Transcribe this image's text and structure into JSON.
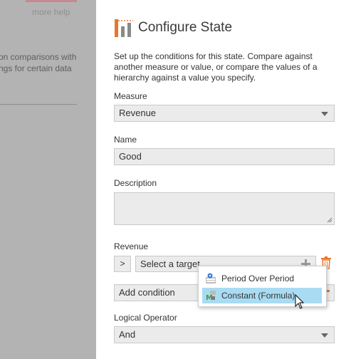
{
  "background": {
    "more_help": "more help",
    "desc_lines": [
      "on comparisons with",
      "ngs for certain data"
    ]
  },
  "dialog": {
    "title": "Configure State",
    "intro": "Set up the conditions for this state. Compare against another measure or value, or compare the values of a hierarchy against a value you specify.",
    "measure_label": "Measure",
    "measure_value": "Revenue",
    "name_label": "Name",
    "name_value": "Good",
    "description_label": "Description",
    "description_value": "",
    "condition_label": "Revenue",
    "operator": ">",
    "target_placeholder": "Select a target",
    "add_condition": "Add condition",
    "logical_operator_label": "Logical Operator",
    "logical_operator_value": "And"
  },
  "target_menu": {
    "items": [
      {
        "label": "Period Over Period",
        "icon": "period-over-period-icon",
        "highlighted": false
      },
      {
        "label": "Constant (Formula)",
        "icon": "constant-formula-icon",
        "highlighted": true
      }
    ]
  },
  "colors": {
    "accent_orange": "#e8762c",
    "highlight": "#a9dcf2",
    "overlay": "#b3b3b3"
  }
}
